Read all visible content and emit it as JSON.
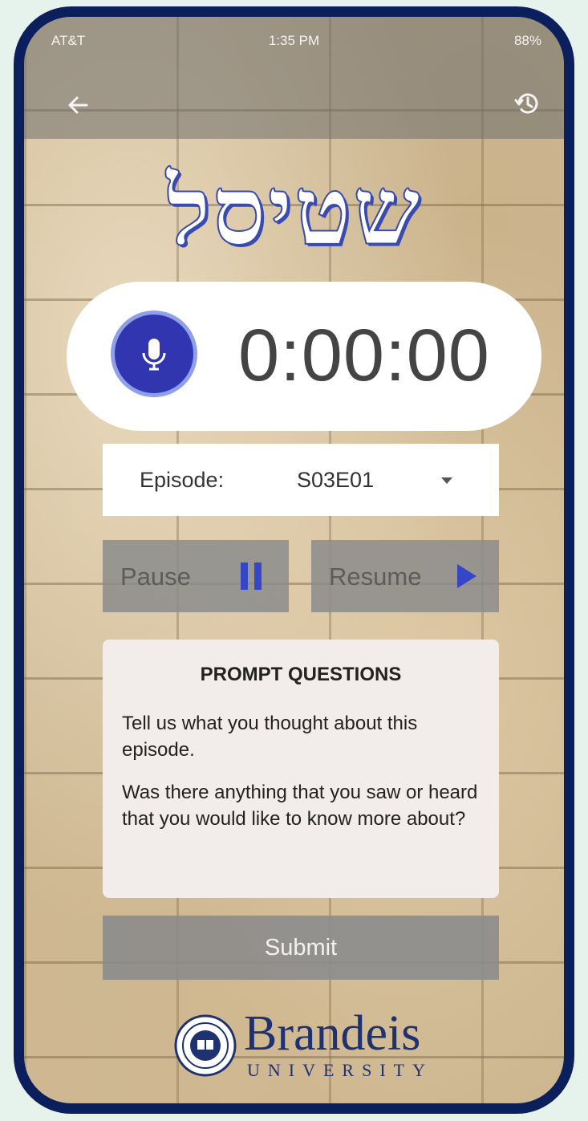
{
  "status_bar": {
    "carrier": "AT&T",
    "time": "1:35 PM",
    "battery": "88%"
  },
  "header": {
    "back_icon": "arrow-left-icon",
    "history_icon": "history-icon"
  },
  "title": "שטיסל",
  "recorder": {
    "mic_icon": "microphone-icon",
    "timer": "0:00:00"
  },
  "episode": {
    "label": "Episode:",
    "selected": "S03E01",
    "caret_icon": "chevron-down-icon"
  },
  "controls": {
    "pause_label": "Pause",
    "pause_icon": "pause-icon",
    "resume_label": "Resume",
    "resume_icon": "play-icon"
  },
  "prompt": {
    "title": "PROMPT QUESTIONS",
    "questions": [
      "Tell us what you thought about this episode.",
      "Was there anything that you saw or heard that you would like to know more about?"
    ]
  },
  "submit_label": "Submit",
  "footer": {
    "logo_text": "Brandeis",
    "logo_sub": "UNIVERSITY"
  },
  "colors": {
    "accent": "#3136b0",
    "frame": "#0b1f5c",
    "button_gray": "#8c8c8c",
    "card": "#f2ecea"
  }
}
